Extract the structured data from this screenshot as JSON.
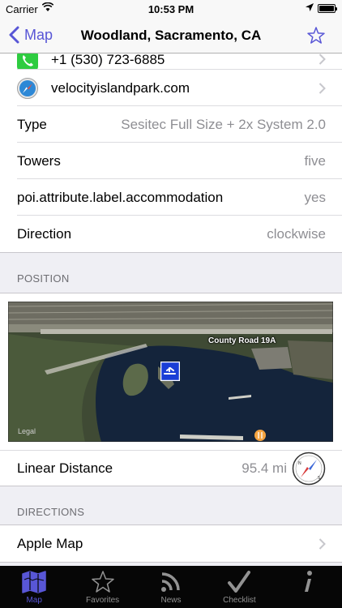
{
  "status": {
    "carrier": "Carrier",
    "time": "10:53 PM"
  },
  "nav": {
    "back_label": "Map",
    "title": "Woodland, Sacramento, CA"
  },
  "contact": {
    "phone": "+1 (530) 723-6885",
    "website": "velocityislandpark.com"
  },
  "details": [
    {
      "label": "Type",
      "value": "Sesitec Full Size + 2x System 2.0"
    },
    {
      "label": "Towers",
      "value": "five"
    },
    {
      "label": "poi.attribute.label.accommodation",
      "value": "yes"
    },
    {
      "label": "Direction",
      "value": "clockwise"
    }
  ],
  "position": {
    "header": "POSITION",
    "map_road_label": "County Road 19A",
    "map_legal": "Legal",
    "distance_label": "Linear Distance",
    "distance_value": "95.4 mi"
  },
  "directions": {
    "header": "DIRECTIONS",
    "apple_map": "Apple Map"
  },
  "tabs": [
    {
      "label": "Map",
      "icon": "map-icon",
      "active": true
    },
    {
      "label": "Favorites",
      "icon": "star-icon",
      "active": false
    },
    {
      "label": "News",
      "icon": "rss-icon",
      "active": false
    },
    {
      "label": "Checklist",
      "icon": "checkmark-icon",
      "active": false
    },
    {
      "label": "",
      "icon": "info-icon",
      "active": false
    }
  ],
  "colors": {
    "accent": "#5856d6",
    "tab_bar": "#060606",
    "water": "#14243b"
  }
}
